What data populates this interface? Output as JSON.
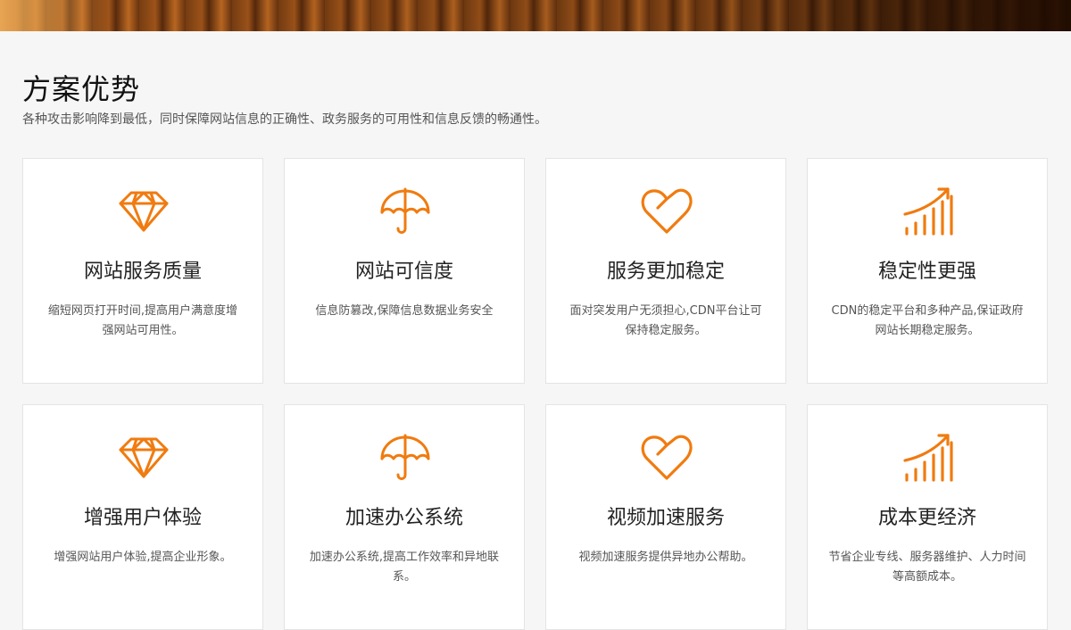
{
  "section": {
    "title": "方案优势",
    "subtitle": "各种攻击影响降到最低，同时保障网站信息的正确性、政务服务的可用性和信息反馈的畅通性。"
  },
  "theme": {
    "accent": "#f07b0f"
  },
  "cards": [
    {
      "icon": "diamond-icon",
      "title": "网站服务质量",
      "desc": "缩短网页打开时间,提高用户满意度增强网站可用性。"
    },
    {
      "icon": "umbrella-icon",
      "title": "网站可信度",
      "desc": "信息防篡改,保障信息数据业务安全"
    },
    {
      "icon": "heart-icon",
      "title": "服务更加稳定",
      "desc": "面对突发用户无须担心,CDN平台让可保持稳定服务。"
    },
    {
      "icon": "growth-chart-icon",
      "title": "稳定性更强",
      "desc": "CDN的稳定平台和多种产品,保证政府网站长期稳定服务。"
    },
    {
      "icon": "diamond-icon",
      "title": "增强用户体验",
      "desc": "增强网站用户体验,提高企业形象。"
    },
    {
      "icon": "umbrella-icon",
      "title": "加速办公系统",
      "desc": "加速办公系统,提高工作效率和异地联系。"
    },
    {
      "icon": "heart-icon",
      "title": "视频加速服务",
      "desc": "视频加速服务提供异地办公帮助。"
    },
    {
      "icon": "growth-chart-icon",
      "title": "成本更经济",
      "desc": "节省企业专线、服务器维护、人力时间等高额成本。"
    }
  ]
}
